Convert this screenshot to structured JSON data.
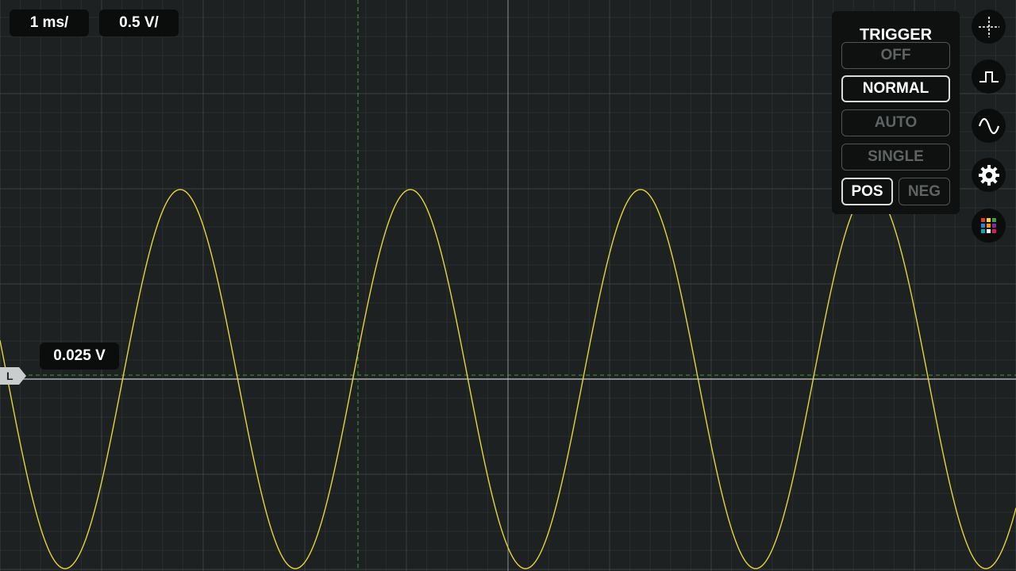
{
  "toolbar": {
    "timebase": "1 ms/",
    "volts_per_div": "0.5 V/"
  },
  "trigger": {
    "title": "TRIGGER",
    "modes": [
      "OFF",
      "NORMAL",
      "AUTO",
      "SINGLE"
    ],
    "active_mode": "NORMAL",
    "slopes": [
      "POS",
      "NEG"
    ],
    "active_slope": "POS",
    "level_label": "0.025 V",
    "level_marker": "L"
  },
  "side_tools": [
    "cursor-icon",
    "pulse-icon",
    "sine-icon",
    "gear-icon",
    "color-palette-icon"
  ],
  "waveform": {
    "color": "#e6d43a",
    "shape": "sine",
    "level_line_color": "#3a8a3a"
  },
  "colors": {
    "background": "#1e2121",
    "grid_major": "#3a3e3e",
    "grid_minor": "#2a2d2d",
    "palette": [
      "#e53935",
      "#fdd835",
      "#43a047",
      "#1e88e5",
      "#ff9800",
      "#8e24aa",
      "#00acc1",
      "#ffffff",
      "#d81b60"
    ]
  }
}
